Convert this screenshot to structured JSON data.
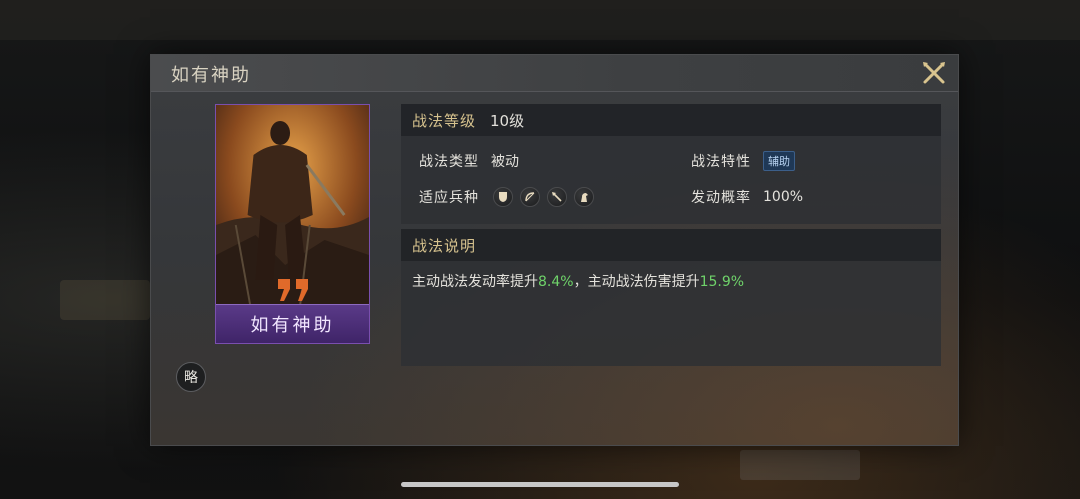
{
  "dialog": {
    "title": "如有神助",
    "close_icon": "close-icon"
  },
  "card": {
    "name": "如有神助",
    "strategy_label": "略"
  },
  "info": {
    "level_label": "战法等级",
    "level_value": "10级",
    "type_label": "战法类型",
    "type_value": "被动",
    "trait_label": "战法特性",
    "trait_value": "辅助",
    "troops_label": "适应兵种",
    "troop_icons": [
      "shield-icon",
      "bow-icon",
      "spear-icon",
      "horse-icon"
    ],
    "prob_label": "发动概率",
    "prob_value": "100%"
  },
  "description": {
    "header": "战法说明",
    "part1": "主动战法发动率提升",
    "value1": "8.4%",
    "part2": "，主动战法伤害提升",
    "value2": "15.9%"
  },
  "colors": {
    "highlight_green": "#6fd36a",
    "header_gold": "#d6c28e",
    "card_purple": "#5a3a88"
  }
}
